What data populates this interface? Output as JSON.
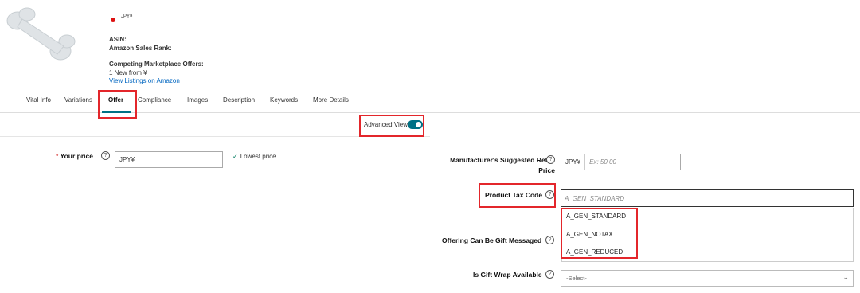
{
  "product": {
    "currency": "JPY¥",
    "asin_label": "ASIN:",
    "sales_rank_label": "Amazon Sales Rank:",
    "competing_label": "Competing Marketplace Offers:",
    "offers_text": "1 New from ¥",
    "view_listings": "View Listings on Amazon"
  },
  "tabs": [
    {
      "label": "Vital Info"
    },
    {
      "label": "Variations"
    },
    {
      "label": "Offer",
      "active": true
    },
    {
      "label": "Compliance"
    },
    {
      "label": "Images"
    },
    {
      "label": "Description"
    },
    {
      "label": "Keywords"
    },
    {
      "label": "More Details"
    }
  ],
  "toolbar": {
    "advanced_view_label": "Advanced View",
    "advanced_view_on": true
  },
  "form": {
    "your_price": {
      "required_mark": "*",
      "label": "Your price",
      "currency": "JPY¥",
      "value": "",
      "lowest_price": "Lowest price"
    },
    "msrp": {
      "label_line1": "Manufacturer's Suggested Retail",
      "label_line2": "Price",
      "currency": "JPY¥",
      "placeholder": "Ex: 50.00"
    },
    "tax_code": {
      "label": "Product Tax Code",
      "placeholder": "A_GEN_STANDARD",
      "options": [
        "A_GEN_STANDARD",
        "A_GEN_NOTAX",
        "A_GEN_REDUCED"
      ]
    },
    "gift_message": {
      "label": "Offering Can Be Gift Messaged"
    },
    "gift_wrap": {
      "label": "Is Gift Wrap Available",
      "selected": "-Select-"
    }
  },
  "colors": {
    "accent": "#007185",
    "highlight": "#e3262b",
    "link": "#0066c0"
  }
}
